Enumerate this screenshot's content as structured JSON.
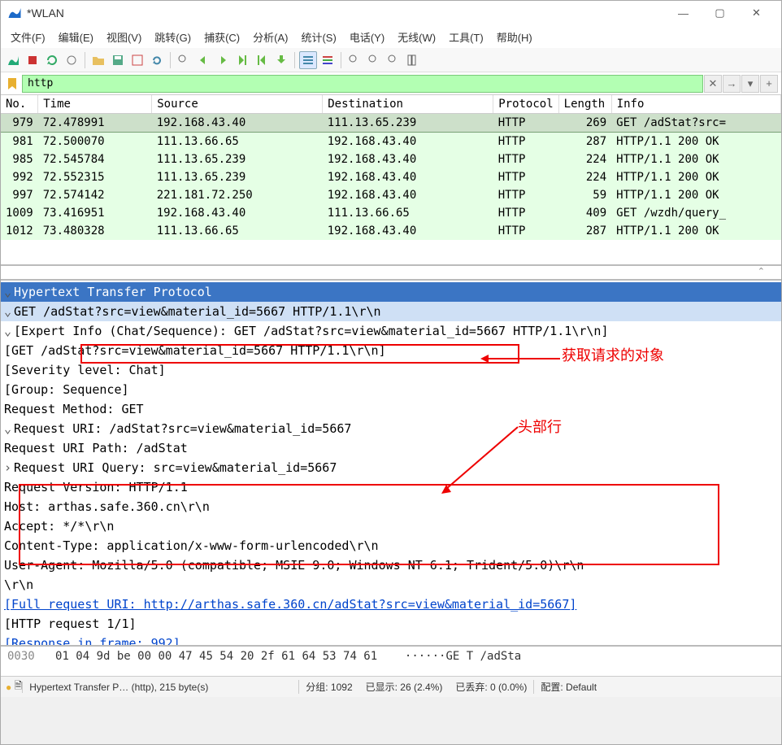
{
  "window": {
    "title": "*WLAN"
  },
  "menu": {
    "file": "文件(F)",
    "edit": "编辑(E)",
    "view": "视图(V)",
    "go": "跳转(G)",
    "capture": "捕获(C)",
    "analyze": "分析(A)",
    "stats": "统计(S)",
    "tel": "电话(Y)",
    "wireless": "无线(W)",
    "tools": "工具(T)",
    "help": "帮助(H)"
  },
  "filter": {
    "value": "http"
  },
  "headers": {
    "no": "No.",
    "time": "Time",
    "source": "Source",
    "dest": "Destination",
    "proto": "Protocol",
    "len": "Length",
    "info": "Info"
  },
  "packets": [
    {
      "no": "979",
      "time": "72.478991",
      "src": "192.168.43.40",
      "dst": "111.13.65.239",
      "proto": "HTTP",
      "len": "269",
      "info": "GET /adStat?src=",
      "sel": true
    },
    {
      "no": "981",
      "time": "72.500070",
      "src": "111.13.66.65",
      "dst": "192.168.43.40",
      "proto": "HTTP",
      "len": "287",
      "info": "HTTP/1.1 200 OK"
    },
    {
      "no": "985",
      "time": "72.545784",
      "src": "111.13.65.239",
      "dst": "192.168.43.40",
      "proto": "HTTP",
      "len": "224",
      "info": "HTTP/1.1 200 OK"
    },
    {
      "no": "992",
      "time": "72.552315",
      "src": "111.13.65.239",
      "dst": "192.168.43.40",
      "proto": "HTTP",
      "len": "224",
      "info": "HTTP/1.1 200 OK"
    },
    {
      "no": "997",
      "time": "72.574142",
      "src": "221.181.72.250",
      "dst": "192.168.43.40",
      "proto": "HTTP",
      "len": "59",
      "info": "HTTP/1.1 200 OK"
    },
    {
      "no": "1009",
      "time": "73.416951",
      "src": "192.168.43.40",
      "dst": "111.13.66.65",
      "proto": "HTTP",
      "len": "409",
      "info": "GET /wzdh/query_"
    },
    {
      "no": "1012",
      "time": "73.480328",
      "src": "111.13.66.65",
      "dst": "192.168.43.40",
      "proto": "HTTP",
      "len": "287",
      "info": "HTTP/1.1 200 OK"
    }
  ],
  "details": {
    "proto_name": "Hypertext Transfer Protocol",
    "get_line": "GET /adStat?src=view&material_id=5667 HTTP/1.1\\r\\n",
    "expert": "[Expert Info (Chat/Sequence): GET /adStat?src=view&material_id=5667 HTTP/1.1\\r\\n]",
    "expert_get": "[GET /adStat?src=view&material_id=5667 HTTP/1.1\\r\\n]",
    "severity": "[Severity level: Chat]",
    "group": "[Group: Sequence]",
    "method": "Request Method: GET",
    "uri": "Request URI: /adStat?src=view&material_id=5667",
    "uri_path": "Request URI Path: /adStat",
    "uri_query": "Request URI Query: src=view&material_id=5667",
    "version": "Request Version: HTTP/1.1",
    "host": "Host: arthas.safe.360.cn\\r\\n",
    "accept": "Accept: */*\\r\\n",
    "ctype": "Content-Type: application/x-www-form-urlencoded\\r\\n",
    "ua": "User-Agent: Mozilla/5.0 (compatible; MSIE 9.0; Windows NT 6.1; Trident/5.0)\\r\\n",
    "crlf": "\\r\\n",
    "full_uri": "[Full request URI: http://arthas.safe.360.cn/adStat?src=view&material_id=5667]",
    "req_num": "[HTTP request 1/1]",
    "resp_frame": "[Response in frame: 992]"
  },
  "annotations": {
    "label1": "获取请求的对象",
    "label2": "头部行"
  },
  "hex": {
    "offset": "0030",
    "bytes": "01 04 9d be 00 00 47 45  54 20 2f 61 64 53 74 61",
    "ascii": "······GE T /adSta"
  },
  "status": {
    "proto": "Hypertext Transfer P… (http), 215 byte(s)",
    "groups": "分组: 1092",
    "shown": "已显示: 26 (2.4%)",
    "dropped": "已丢弃: 0 (0.0%)",
    "profile": "配置: Default"
  }
}
